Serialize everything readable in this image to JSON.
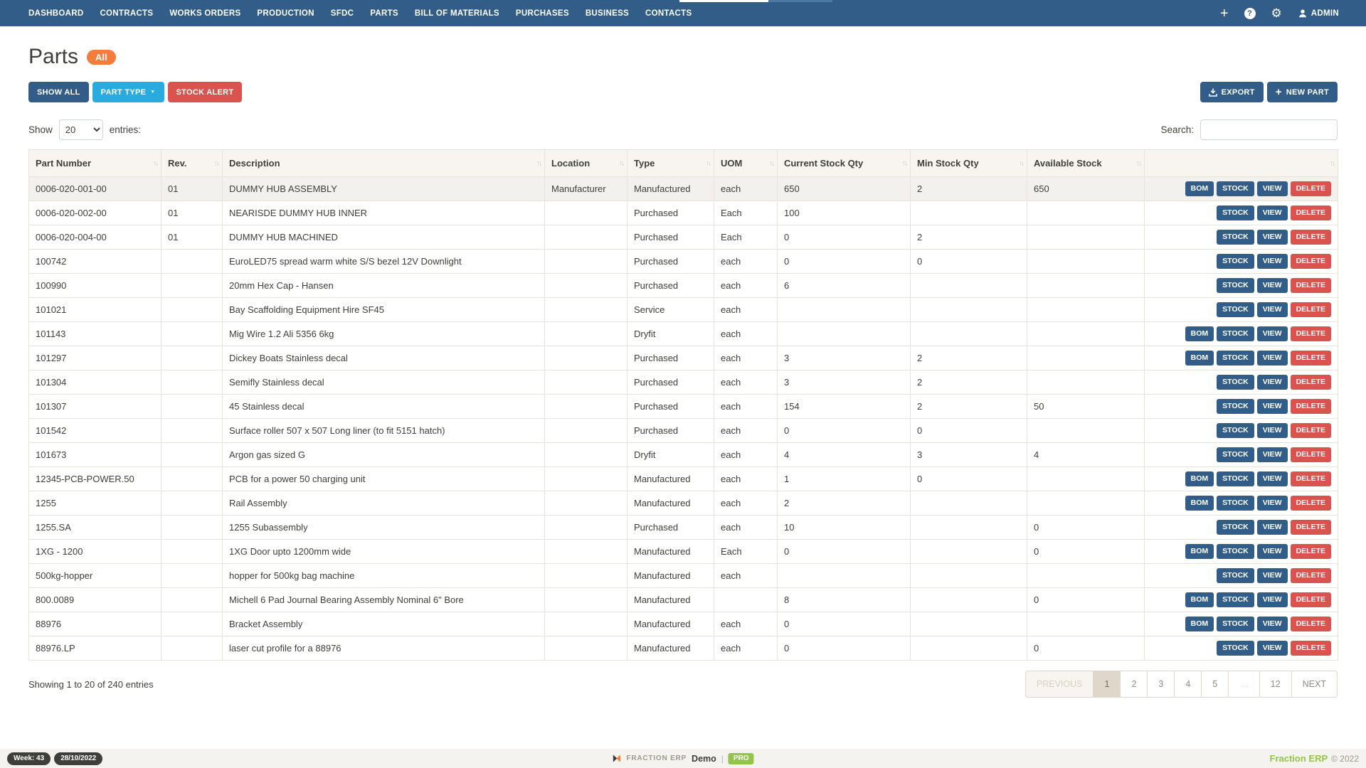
{
  "nav": {
    "items": [
      "DASHBOARD",
      "CONTRACTS",
      "WORKS ORDERS",
      "PRODUCTION",
      "SFDC",
      "PARTS",
      "BILL OF MATERIALS",
      "PURCHASES",
      "BUSINESS",
      "CONTACTS"
    ],
    "admin_label": "ADMIN"
  },
  "header": {
    "title": "Parts",
    "badge": "All"
  },
  "toolbar": {
    "show_all": "SHOW ALL",
    "part_type": "PART TYPE",
    "stock_alert": "STOCK ALERT",
    "export": "EXPORT",
    "new_part": "NEW PART"
  },
  "controls": {
    "show_label": "Show",
    "page_size": "20",
    "entries_label": "entries:",
    "search_label": "Search:"
  },
  "table": {
    "columns": [
      "Part Number",
      "Rev.",
      "Description",
      "Location",
      "Type",
      "UOM",
      "Current Stock Qty",
      "Min Stock Qty",
      "Available Stock",
      ""
    ],
    "action_labels": {
      "bom": "BOM",
      "stock": "STOCK",
      "view": "VIEW",
      "delete": "DELETE"
    },
    "rows": [
      {
        "part_number": "0006-020-001-00",
        "rev": "01",
        "description": "DUMMY HUB ASSEMBLY",
        "location": "Manufacturer",
        "type": "Manufactured",
        "uom": "each",
        "current": "650",
        "min": "2",
        "available": "650",
        "bom": true,
        "highlight": true
      },
      {
        "part_number": "0006-020-002-00",
        "rev": "01",
        "description": "NEARISDE DUMMY HUB INNER",
        "location": "",
        "type": "Purchased",
        "uom": "Each",
        "current": "100",
        "min": "",
        "available": "",
        "bom": false
      },
      {
        "part_number": "0006-020-004-00",
        "rev": "01",
        "description": "DUMMY HUB MACHINED",
        "location": "",
        "type": "Purchased",
        "uom": "Each",
        "current": "0",
        "min": "2",
        "available": "",
        "bom": false
      },
      {
        "part_number": "100742",
        "rev": "",
        "description": "EuroLED75 spread warm white S/S bezel 12V Downlight",
        "location": "",
        "type": "Purchased",
        "uom": "each",
        "current": "0",
        "min": "0",
        "available": "",
        "bom": false
      },
      {
        "part_number": "100990",
        "rev": "",
        "description": "20mm Hex Cap - Hansen",
        "location": "",
        "type": "Purchased",
        "uom": "each",
        "current": "6",
        "min": "",
        "available": "",
        "bom": false
      },
      {
        "part_number": "101021",
        "rev": "",
        "description": "Bay Scaffolding Equipment Hire SF45",
        "location": "",
        "type": "Service",
        "uom": "each",
        "current": "",
        "min": "",
        "available": "",
        "bom": false
      },
      {
        "part_number": "101143",
        "rev": "",
        "description": "Mig Wire 1.2 Ali 5356 6kg",
        "location": "",
        "type": "Dryfit",
        "uom": "each",
        "current": "",
        "min": "",
        "available": "",
        "bom": true
      },
      {
        "part_number": "101297",
        "rev": "",
        "description": "Dickey Boats Stainless decal",
        "location": "",
        "type": "Purchased",
        "uom": "each",
        "current": "3",
        "min": "2",
        "available": "",
        "bom": true
      },
      {
        "part_number": "101304",
        "rev": "",
        "description": "Semifly Stainless decal",
        "location": "",
        "type": "Purchased",
        "uom": "each",
        "current": "3",
        "min": "2",
        "available": "",
        "bom": false
      },
      {
        "part_number": "101307",
        "rev": "",
        "description": "45 Stainless decal",
        "location": "",
        "type": "Purchased",
        "uom": "each",
        "current": "154",
        "min": "2",
        "available": "50",
        "bom": false
      },
      {
        "part_number": "101542",
        "rev": "",
        "description": "Surface roller 507 x 507 Long liner (to fit 5151 hatch)",
        "location": "",
        "type": "Purchased",
        "uom": "each",
        "current": "0",
        "min": "0",
        "available": "",
        "bom": false
      },
      {
        "part_number": "101673",
        "rev": "",
        "description": "Argon gas sized G",
        "location": "",
        "type": "Dryfit",
        "uom": "each",
        "current": "4",
        "min": "3",
        "available": "4",
        "bom": false
      },
      {
        "part_number": "12345-PCB-POWER.50",
        "rev": "",
        "description": "PCB for a power 50 charging unit",
        "location": "",
        "type": "Manufactured",
        "uom": "each",
        "current": "1",
        "min": "0",
        "available": "",
        "bom": true
      },
      {
        "part_number": "1255",
        "rev": "",
        "description": "Rail Assembly",
        "location": "",
        "type": "Manufactured",
        "uom": "each",
        "current": "2",
        "min": "",
        "available": "",
        "bom": true
      },
      {
        "part_number": "1255.SA",
        "rev": "",
        "description": "1255 Subassembly",
        "location": "",
        "type": "Purchased",
        "uom": "each",
        "current": "10",
        "min": "",
        "available": "0",
        "bom": false
      },
      {
        "part_number": "1XG - 1200",
        "rev": "",
        "description": "1XG Door upto 1200mm wide",
        "location": "",
        "type": "Manufactured",
        "uom": "Each",
        "current": "0",
        "min": "",
        "available": "0",
        "bom": true
      },
      {
        "part_number": "500kg-hopper",
        "rev": "",
        "description": "hopper for 500kg bag machine",
        "location": "",
        "type": "Manufactured",
        "uom": "each",
        "current": "",
        "min": "",
        "available": "",
        "bom": false
      },
      {
        "part_number": "800.0089",
        "rev": "",
        "description": "Michell 6 Pad Journal Bearing Assembly Nominal 6\" Bore",
        "location": "",
        "type": "Manufactured",
        "uom": "",
        "current": "8",
        "min": "",
        "available": "0",
        "bom": true
      },
      {
        "part_number": "88976",
        "rev": "",
        "description": "Bracket Assembly",
        "location": "",
        "type": "Manufactured",
        "uom": "each",
        "current": "0",
        "min": "",
        "available": "",
        "bom": true
      },
      {
        "part_number": "88976.LP",
        "rev": "",
        "description": "laser cut profile for a 88976",
        "location": "",
        "type": "Manufactured",
        "uom": "each",
        "current": "0",
        "min": "",
        "available": "0",
        "bom": false
      }
    ]
  },
  "footer": {
    "showing": "Showing 1 to 20 of 240 entries",
    "pagination": {
      "pages": [
        {
          "label": "PREVIOUS",
          "state": "prev"
        },
        {
          "label": "1",
          "state": "active"
        },
        {
          "label": "2",
          "state": ""
        },
        {
          "label": "3",
          "state": ""
        },
        {
          "label": "4",
          "state": ""
        },
        {
          "label": "5",
          "state": ""
        },
        {
          "label": "…",
          "state": "ellipsis"
        },
        {
          "label": "12",
          "state": ""
        },
        {
          "label": "NEXT",
          "state": ""
        }
      ]
    }
  },
  "statusbar": {
    "week": "Week: 43",
    "date": "28/10/2022",
    "brand_small": "FRACTION ERP",
    "brand_mode": "Demo",
    "separator": "|",
    "pro": "PRO",
    "brand_right": "Fraction ERP",
    "copyright": "© 2022"
  },
  "colors": {
    "navbar": "#325D88",
    "info_button": "#29ABE0",
    "danger_button": "#d9534f",
    "badge_orange": "#F47C3C",
    "success_green": "#93C54B",
    "text": "#3E3F3A",
    "table_header_bg": "#f8f5f0",
    "pagination_active_bg": "#dfd7ca"
  }
}
